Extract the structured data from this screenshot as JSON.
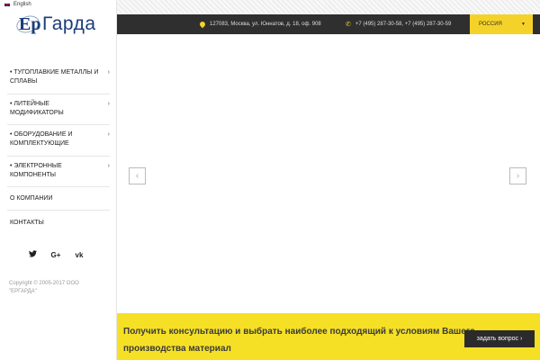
{
  "language": {
    "label": "English",
    "flag_icon": "uk-flag-icon"
  },
  "logo": {
    "mark": "Ер",
    "text": "Гарда"
  },
  "menu": {
    "items": [
      {
        "label": "• ТУГОПЛАВКИЕ МЕТАЛЛЫ И СПЛАВЫ",
        "has_submenu": true
      },
      {
        "label": "• ЛИТЕЙНЫЕ МОДИФИКАТОРЫ",
        "has_submenu": true
      },
      {
        "label": "• ОБОРУДОВАНИЕ И КОМПЛЕКТУЮЩИЕ",
        "has_submenu": true
      },
      {
        "label": "• ЭЛЕКТРОННЫЕ КОМПОНЕНТЫ",
        "has_submenu": true
      },
      {
        "label": "О КОМПАНИИ",
        "has_submenu": false
      },
      {
        "label": "КОНТАКТЫ",
        "has_submenu": false
      }
    ],
    "arrow_glyph": "›"
  },
  "social": [
    {
      "icon": "twitter-icon",
      "glyph": "🐦"
    },
    {
      "icon": "google-plus-icon",
      "glyph": "G+"
    },
    {
      "icon": "vk-icon",
      "glyph": "vk"
    }
  ],
  "copyright": "Copyright © 2005-2017 ООО \"ЕРГАРДА\"",
  "header": {
    "address": "127083, Москва, ул. Юннатов, д. 18, оф. 908",
    "phone": "+7 (495) 287-30-58, +7 (495) 287-30-59",
    "region": "РОССИЯ",
    "region_caret": "▼"
  },
  "slider": {
    "prev_glyph": "‹",
    "next_glyph": "›"
  },
  "consult": {
    "text": "Получить консультацию и выбрать наиболее подходящий к условиям Вашего производства материал",
    "button_label": "задать вопрос",
    "button_arrow": "›"
  },
  "colors": {
    "accent_yellow": "#f5e025",
    "dark_bar": "#2f2f2f",
    "brand_blue": "#1b3c7a"
  }
}
